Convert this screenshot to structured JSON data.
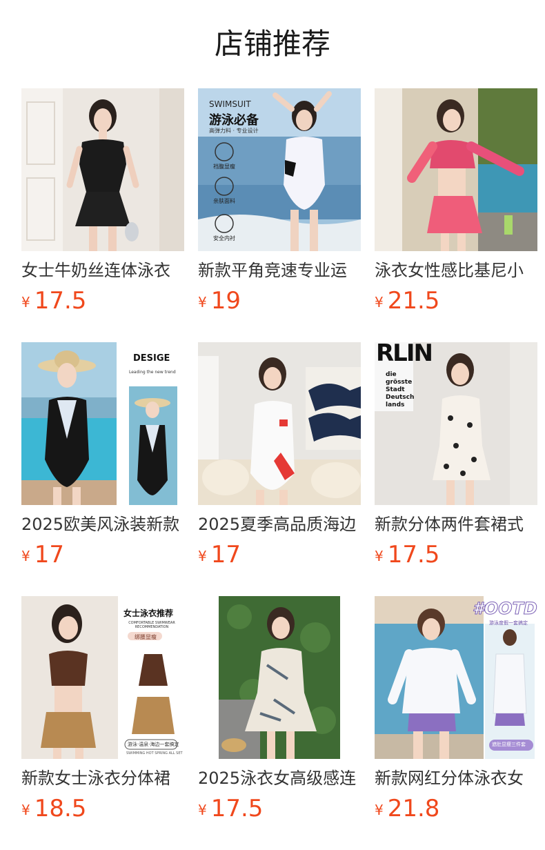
{
  "page": {
    "title": "店铺推荐",
    "currency": "¥"
  },
  "colors": {
    "price": "#f0481c",
    "title_text": "#333333",
    "background": "#ffffff"
  },
  "products": [
    {
      "title": "女士牛奶丝连体泳衣",
      "price": "17.5",
      "image": "woman-black-skirt-swimsuit-photo"
    },
    {
      "title": "新款平角竞速专业运",
      "price": "19",
      "image": "woman-white-swimsuit-beach-photo",
      "overlay": {
        "brand": "SWIMSUIT",
        "headline": "游泳必备",
        "subline": "高弹力料 · 专业设计",
        "features": [
          "裆腹显瘦",
          "亲肤面料",
          "安全内衬"
        ]
      }
    },
    {
      "title": "泳衣女性感比基尼小",
      "price": "21.5",
      "image": "woman-floral-bikini-pool-photo"
    },
    {
      "title": "2025欧美风泳装新款",
      "price": "17",
      "image": "woman-black-swimsuit-straw-hat-photo",
      "overlay": {
        "headline": "DESIGE",
        "subline": "Leading the new trend"
      }
    },
    {
      "title": "2025夏季高品质海边",
      "price": "17",
      "image": "woman-white-red-swimsuit-living-room-photo"
    },
    {
      "title": "新款分体两件套裙式",
      "price": "17.5",
      "image": "woman-floral-print-swimdress-photo",
      "overlay": {
        "poster_big": "RLIN",
        "poster_lines": [
          "die",
          "grösste",
          "Stadt",
          "Deutsch",
          "lands"
        ]
      }
    },
    {
      "title": "新款女士泳衣分体裙",
      "price": "18.5",
      "image": "woman-brown-bikini-skirt-photo",
      "overlay": {
        "headline": "女士泳衣推荐",
        "subline": "COMFORTABLE SWIMWEAR RECOMMENDATION",
        "tag": "绑腰显瘦",
        "footer": "游泳·温泉·海边一套搞定",
        "footer_en": "SWIMMING HOT SPRING ALL SET"
      }
    },
    {
      "title": "2025泳衣女高级感连",
      "price": "17.5",
      "image": "woman-printed-ruffle-swimdress-photo"
    },
    {
      "title": "新款网红分体泳衣女",
      "price": "21.8",
      "image": "woman-white-longsleeve-pool-photo",
      "overlay": {
        "headline": "#OOTD",
        "subline": "游泳度假一套搞定",
        "tag": "遮肚显瘦三件套"
      }
    }
  ]
}
